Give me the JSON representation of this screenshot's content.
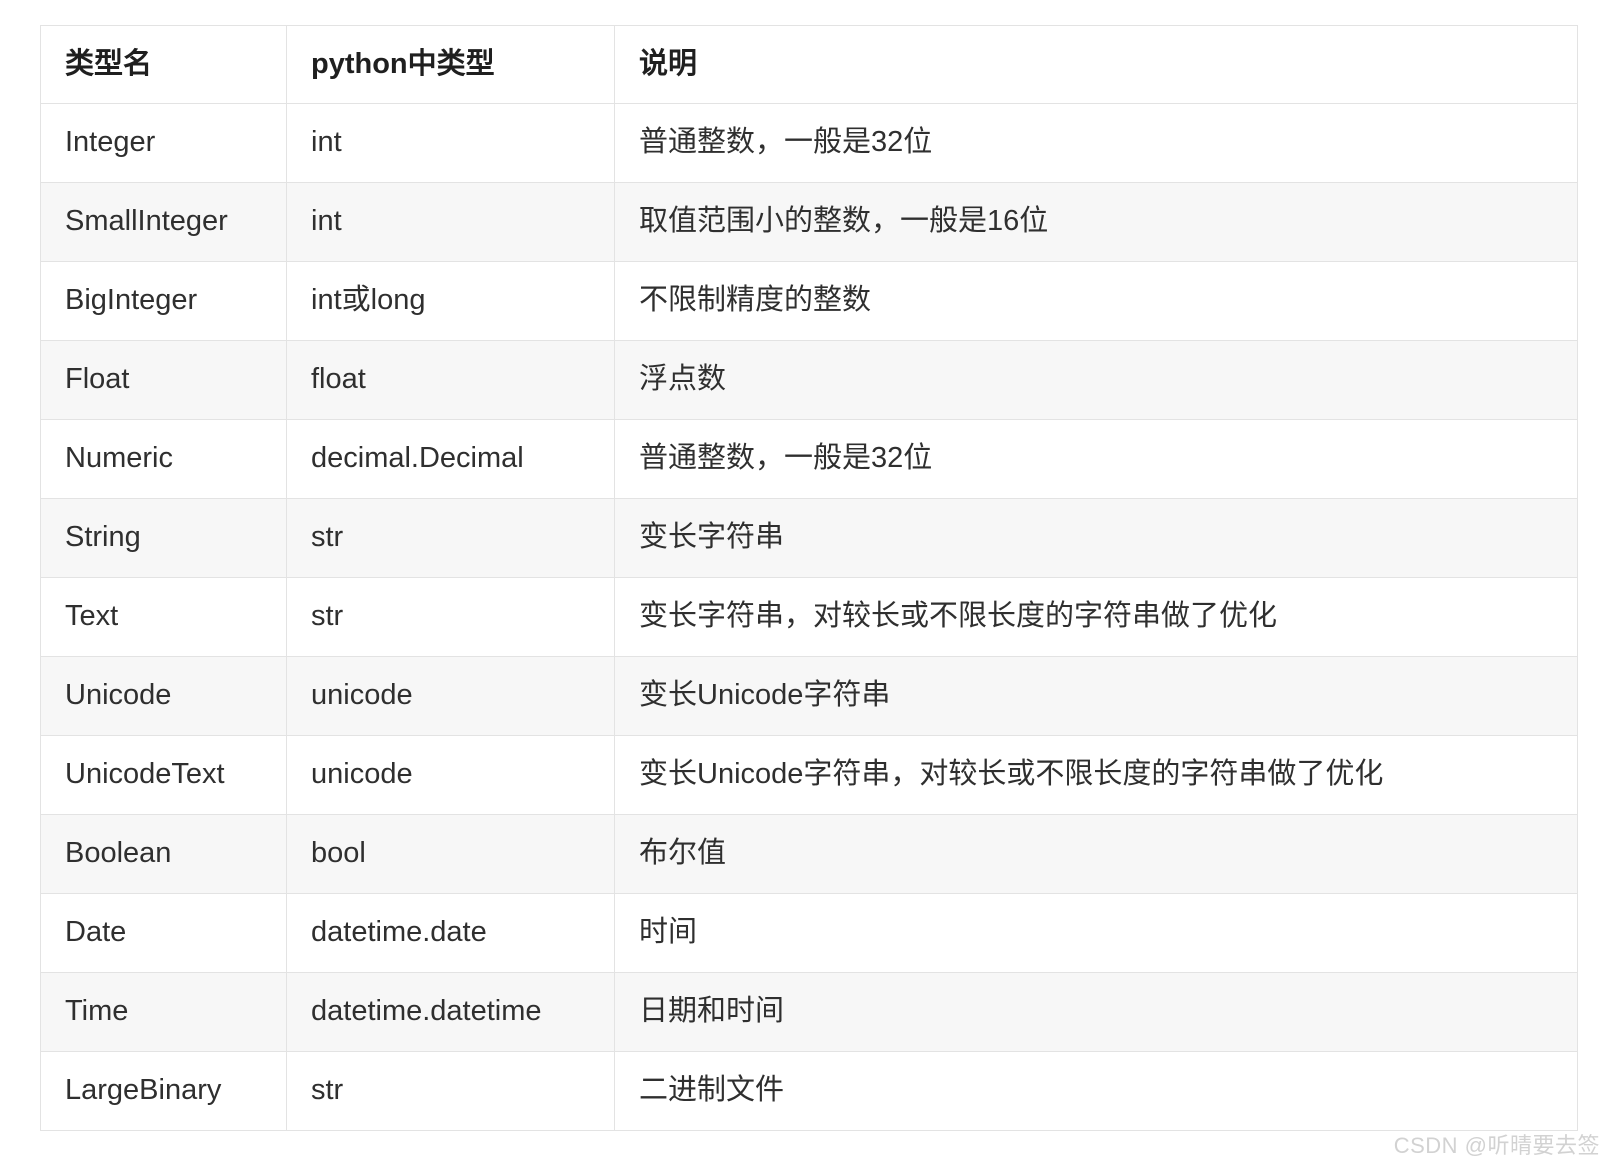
{
  "table": {
    "headers": [
      "类型名",
      "python中类型",
      "说明"
    ],
    "rows": [
      {
        "type": "Integer",
        "python": "int",
        "desc": "普通整数，一般是32位"
      },
      {
        "type": "SmallInteger",
        "python": "int",
        "desc": "取值范围小的整数，一般是16位"
      },
      {
        "type": "BigInteger",
        "python": "int或long",
        "desc": "不限制精度的整数"
      },
      {
        "type": "Float",
        "python": "float",
        "desc": "浮点数"
      },
      {
        "type": "Numeric",
        "python": "decimal.Decimal",
        "desc": "普通整数，一般是32位"
      },
      {
        "type": "String",
        "python": "str",
        "desc": "变长字符串"
      },
      {
        "type": "Text",
        "python": "str",
        "desc": "变长字符串，对较长或不限长度的字符串做了优化"
      },
      {
        "type": "Unicode",
        "python": "unicode",
        "desc": "变长Unicode字符串"
      },
      {
        "type": "UnicodeText",
        "python": "unicode",
        "desc": "变长Unicode字符串，对较长或不限长度的字符串做了优化"
      },
      {
        "type": "Boolean",
        "python": "bool",
        "desc": "布尔值"
      },
      {
        "type": "Date",
        "python": "datetime.date",
        "desc": "时间"
      },
      {
        "type": "Time",
        "python": "datetime.datetime",
        "desc": "日期和时间"
      },
      {
        "type": "LargeBinary",
        "python": "str",
        "desc": "二进制文件"
      }
    ]
  },
  "watermark": {
    "text": "CSDN @听晴要去签"
  },
  "colors": {
    "border": "#e3e3e3",
    "outer_border": "#dcdcdc",
    "row_shaded": "#f7f7f7",
    "row_plain": "#ffffff",
    "text": "#2f2f2f",
    "header_text": "#1f1f1f",
    "watermark": "#d2d2d2"
  }
}
